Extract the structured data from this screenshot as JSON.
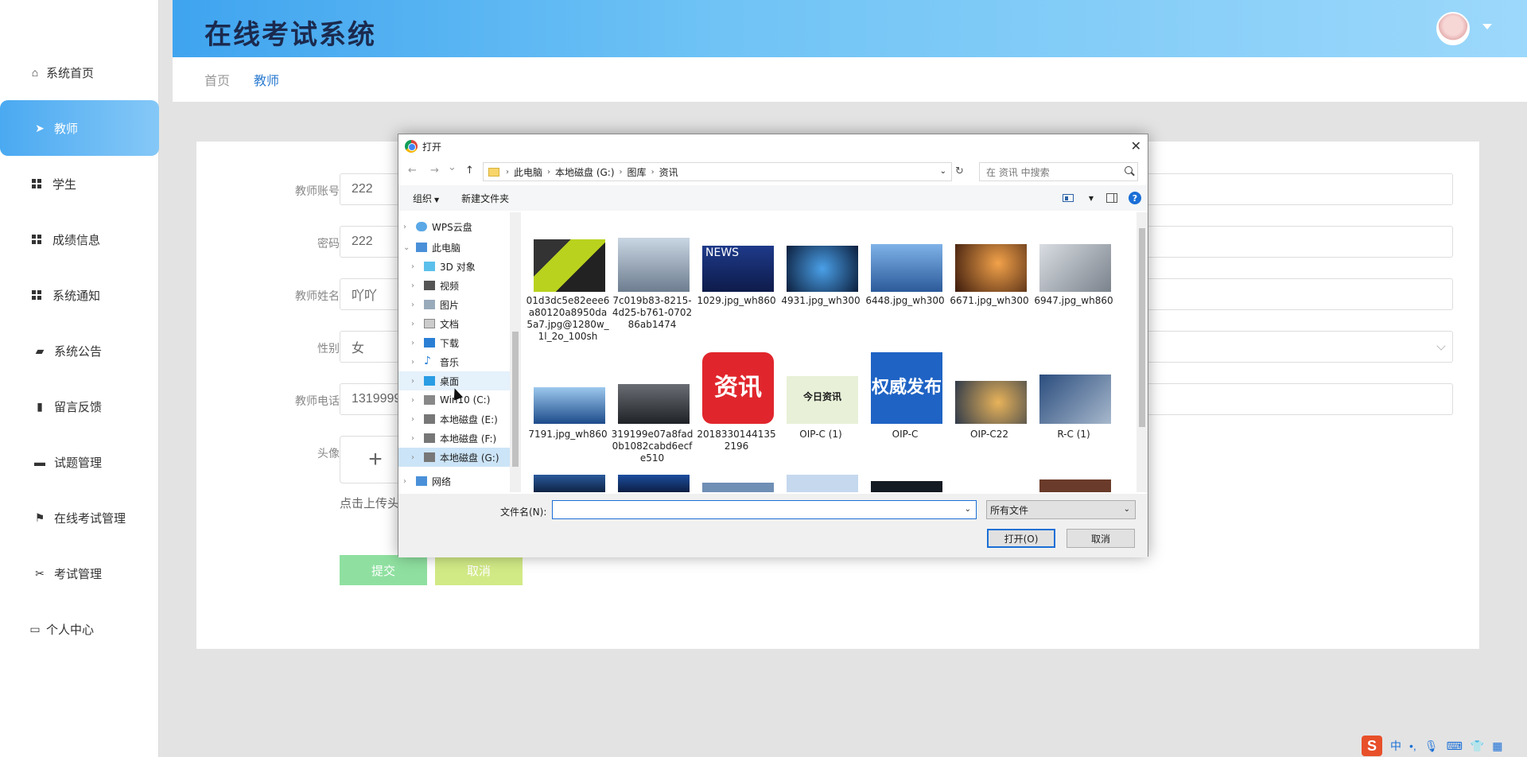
{
  "header": {
    "title": "在线考试系统"
  },
  "breadcrumb": {
    "home": "首页",
    "current": "教师"
  },
  "sidebar": {
    "items": [
      {
        "label": "系统首页"
      },
      {
        "label": "教师"
      },
      {
        "label": "学生"
      },
      {
        "label": "成绩信息"
      },
      {
        "label": "系统通知"
      },
      {
        "label": "系统公告"
      },
      {
        "label": "留言反馈"
      },
      {
        "label": "试题管理"
      },
      {
        "label": "在线考试管理"
      },
      {
        "label": "考试管理"
      },
      {
        "label": "个人中心"
      }
    ]
  },
  "form": {
    "account_label": "教师账号",
    "account_value": "222",
    "password_label": "密码",
    "password_value": "222",
    "name_label": "教师姓名",
    "name_value": "吖吖",
    "gender_label": "性别",
    "gender_value": "女",
    "phone_label": "教师电话",
    "phone_value": "1319999",
    "avatar_label": "头像",
    "upload_plus": "+",
    "upload_tip": "点击上传头",
    "submit": "提交",
    "cancel": "取消"
  },
  "dialog": {
    "title": "打开",
    "close": "✕",
    "nav_back": "←",
    "nav_forward": "→",
    "nav_recent": "⌄",
    "nav_up": "↑",
    "path": [
      "此电脑",
      "本地磁盘 (G:)",
      "图库",
      "资讯"
    ],
    "search_placeholder": "在 资讯 中搜索",
    "toolbar": {
      "organize": "组织",
      "new_folder": "新建文件夹"
    },
    "nav_tree": [
      {
        "label": "WPS云盘"
      },
      {
        "label": "此电脑"
      },
      {
        "label": "3D 对象"
      },
      {
        "label": "视频"
      },
      {
        "label": "图片"
      },
      {
        "label": "文档"
      },
      {
        "label": "下载"
      },
      {
        "label": "音乐"
      },
      {
        "label": "桌面"
      },
      {
        "label": "Win10 (C:)"
      },
      {
        "label": "本地磁盘 (E:)"
      },
      {
        "label": "本地磁盘 (F:)"
      },
      {
        "label": "本地磁盘 (G:)"
      },
      {
        "label": "网络"
      }
    ],
    "files": [
      {
        "name": "01d3dc5e82eee6a80120a8950da5a7.jpg@1280w_1l_2o_100sh"
      },
      {
        "name": "7c019b83-8215-4d25-b761-070286ab1474"
      },
      {
        "name": "1029.jpg_wh860",
        "thumb_text": "NEWS"
      },
      {
        "name": "4931.jpg_wh300"
      },
      {
        "name": "6448.jpg_wh300"
      },
      {
        "name": "6671.jpg_wh300"
      },
      {
        "name": "6947.jpg_wh860"
      },
      {
        "name": "7191.jpg_wh860"
      },
      {
        "name": "319199e07a8fad0b1082cabd6ecfe510"
      },
      {
        "name": "20183301441352196",
        "thumb_text": "资讯"
      },
      {
        "name": "OIP-C (1)",
        "thumb_text": "今日资讯"
      },
      {
        "name": "OIP-C",
        "thumb_text": "权威发布"
      },
      {
        "name": "OIP-C22"
      },
      {
        "name": "R-C (1)"
      }
    ],
    "filename_label": "文件名(N):",
    "filetype": "所有文件",
    "open_button": "打开(O)",
    "cancel_button": "取消"
  },
  "ime": {
    "lang": "中",
    "punct": "•,",
    "logo": "S"
  },
  "colors": {
    "header_gradient_start": "#3fa4ef",
    "active_sidebar": "#4aa9f1",
    "submit": "#8fe0a0",
    "cancel": "#d2ea86",
    "dialog_accent": "#1a6fd6"
  }
}
